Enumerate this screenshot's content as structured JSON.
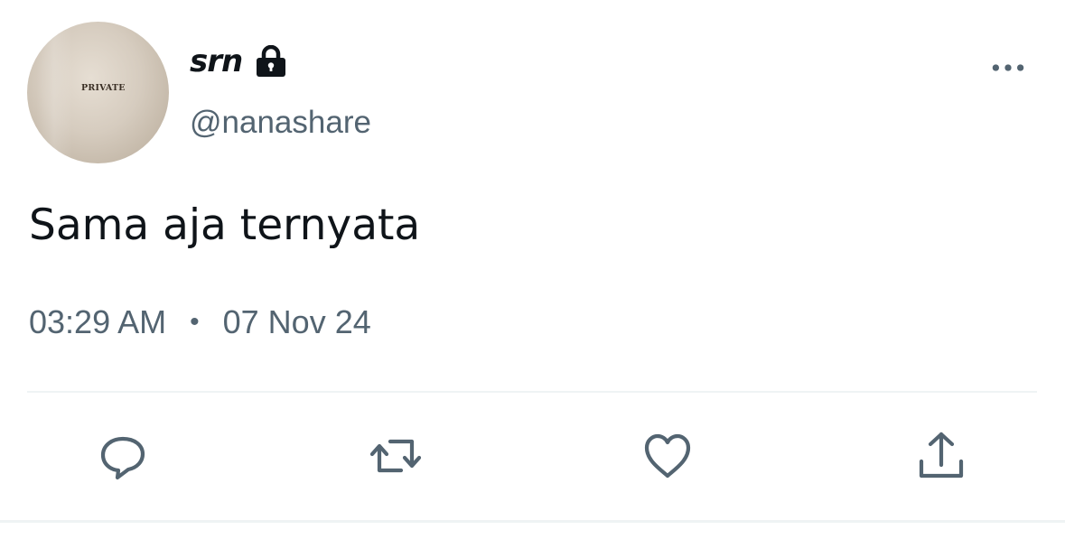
{
  "author": {
    "avatar_label": "PRIVATE",
    "display_name": "srn",
    "handle": "@nanashare",
    "locked_icon": "lock-icon"
  },
  "tweet": {
    "text": "Sama aja ternyata",
    "time": "03:29 AM",
    "separator": "•",
    "date": "07 Nov 24"
  },
  "actions": {
    "reply_icon": "reply-icon",
    "retweet_icon": "retweet-icon",
    "like_icon": "like-icon",
    "share_icon": "share-icon",
    "more_icon": "more-icon"
  },
  "colors": {
    "text": "#0f1419",
    "secondary": "#536471",
    "divider": "#eff3f4"
  }
}
